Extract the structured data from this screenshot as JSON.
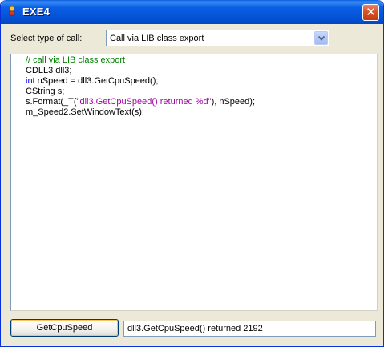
{
  "window": {
    "title": "EXE4",
    "close_glyph": "✕",
    "icon": "app-figure-icon"
  },
  "call_type": {
    "label": "Select type of call:",
    "selected": "Call via LIB class export"
  },
  "code": {
    "lines": [
      {
        "kind": "comment",
        "text": "// call via LIB class export"
      },
      {
        "kind": "plain",
        "text": "CDLL3 dll3;"
      },
      {
        "keyword": "int",
        "rest": " nSpeed = dll3.GetCpuSpeed();"
      },
      {
        "kind": "plain",
        "text": "CString s;"
      },
      {
        "pre": "s.Format(_T(",
        "string": "\"dll3.GetCpuSpeed() returned %d\"",
        "post": "), nSpeed);"
      },
      {
        "kind": "plain",
        "text": "m_Speed2.SetWindowText(s);"
      }
    ]
  },
  "footer": {
    "button_label": "GetCpuSpeed",
    "result": "dll3.GetCpuSpeed() returned 2192"
  },
  "colors": {
    "comment": "#008000",
    "keyword": "#0000ff",
    "string": "#a000a0",
    "titlebar": "#0453d8",
    "close": "#d9532a"
  }
}
